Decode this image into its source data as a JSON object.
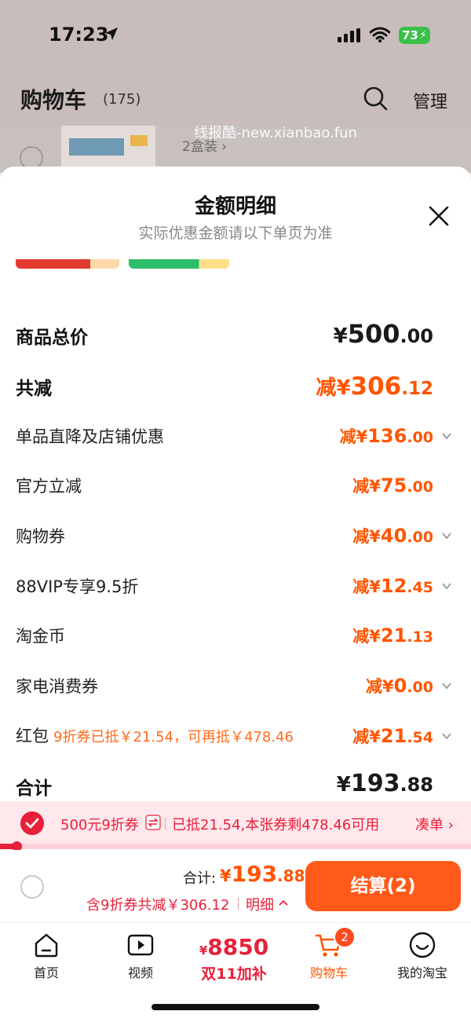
{
  "status_bar": {
    "time": "17:23",
    "battery": "73"
  },
  "cart_header": {
    "title": "购物车",
    "count": "(175)",
    "manage_label": "管理"
  },
  "background_item": {
    "spec": "2盒装 ›",
    "watermark": "线报酷-new.xianbao.fun"
  },
  "sheet": {
    "title": "金额明细",
    "subtitle": "实际优惠金额请以下单页为准",
    "rows": [
      {
        "label": "商品总价",
        "prefix": "",
        "currency": "¥",
        "int": "500",
        "dec": ".00"
      },
      {
        "label": "共减",
        "prefix": "减",
        "currency": "¥",
        "int": "306",
        "dec": ".12"
      },
      {
        "label": "单品直降及店铺优惠",
        "prefix": "减",
        "currency": "¥",
        "int": "136",
        "dec": ".00"
      },
      {
        "label": "官方立减",
        "prefix": "减",
        "currency": "¥",
        "int": "75",
        "dec": ".00"
      },
      {
        "label": "购物券",
        "prefix": "减",
        "currency": "¥",
        "int": "40",
        "dec": ".00"
      },
      {
        "label": "88VIP专享9.5折",
        "prefix": "减",
        "currency": "¥",
        "int": "12",
        "dec": ".45"
      },
      {
        "label": "淘金币",
        "prefix": "减",
        "currency": "¥",
        "int": "21",
        "dec": ".13"
      },
      {
        "label": "家电消费券",
        "prefix": "减",
        "currency": "¥",
        "int": "0",
        "dec": ".00"
      },
      {
        "label": "红包",
        "note": "9折券已抵￥21.54，可再抵￥478.46",
        "prefix": "减",
        "currency": "¥",
        "int": "21",
        "dec": ".54"
      },
      {
        "label": "合计",
        "prefix": "",
        "currency": "¥",
        "int": "193",
        "dec": ".88"
      }
    ]
  },
  "coupon": {
    "name": "500元9折券",
    "detail": "已抵21.54,本张券剩478.46可用",
    "action": "凑单 ›",
    "progress": 0.03
  },
  "checkout": {
    "total_label": "合计:",
    "currency": "¥",
    "int": "193",
    "dec": ".88",
    "savings": "含9折券共减￥306.12",
    "detail_link": "明细",
    "button": "结算(2)"
  },
  "tabbar": {
    "tabs": [
      {
        "label": "首页",
        "icon": "home-icon"
      },
      {
        "label": "视频",
        "icon": "video-icon"
      },
      {
        "promo_yen": "¥",
        "promo_value": "8850",
        "promo_label": "双11加补"
      },
      {
        "label": "购物车",
        "icon": "cart-icon",
        "badge": "2"
      },
      {
        "label": "我的淘宝",
        "icon": "profile-icon"
      }
    ]
  },
  "colors": {
    "accent": "#ff5500",
    "red": "#e8203a",
    "coupon_bg": "#ffe8ec",
    "checkout_button": "#ff5a1a"
  }
}
